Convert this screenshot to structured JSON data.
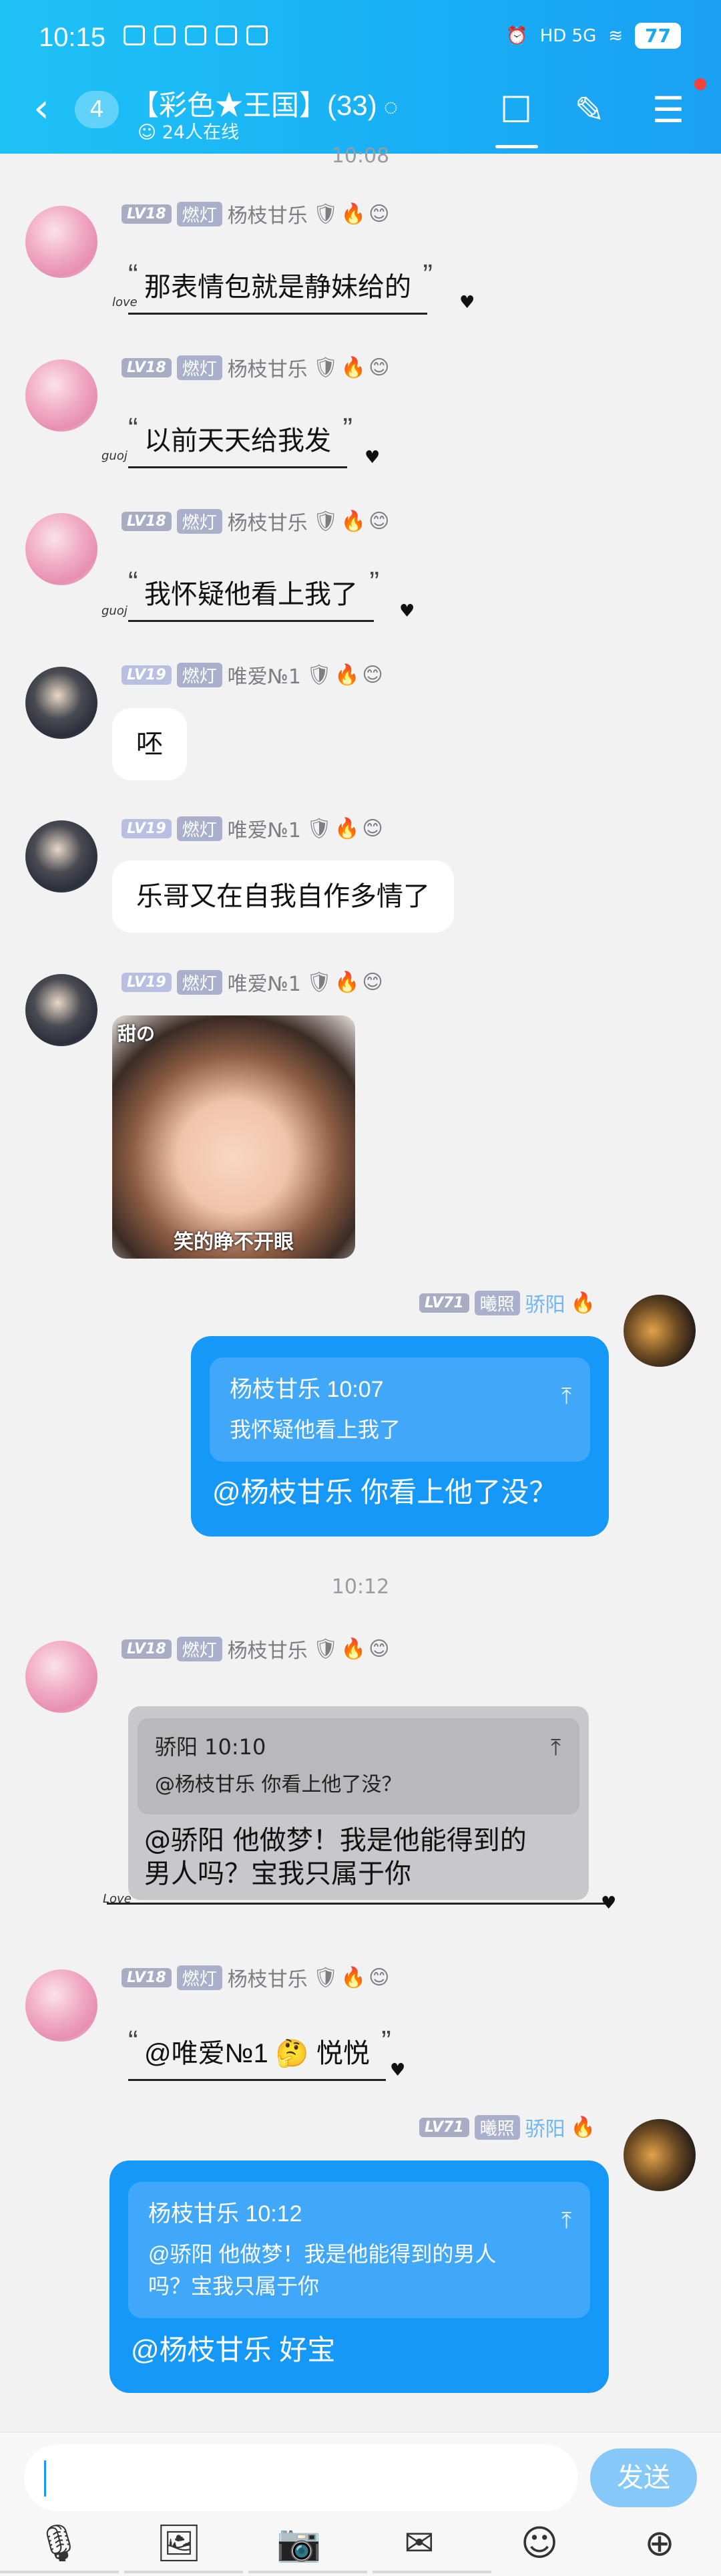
{
  "status_bar": {
    "time": "10:15",
    "network": "HD 5G",
    "battery": "77"
  },
  "header": {
    "back_icon": "chevron-left-icon",
    "unread_count": "4",
    "title": "【彩色★王国】(33)",
    "online": "24人在线",
    "icons": [
      "chat-bubble-icon",
      "edit-note-icon",
      "menu-icon"
    ]
  },
  "top_time": "10:08",
  "messages": [
    {
      "lv": "LV18",
      "badge": "燃灯",
      "nick": "杨枝甘乐",
      "text": "那表情包就是静妹给的",
      "deco_left": "love"
    },
    {
      "lv": "LV18",
      "badge": "燃灯",
      "nick": "杨枝甘乐",
      "text": "以前天天给我发",
      "deco_left": "guoj"
    },
    {
      "lv": "LV18",
      "badge": "燃灯",
      "nick": "杨枝甘乐",
      "text": "我怀疑他看上我了",
      "deco_left": "guoj"
    },
    {
      "lv": "LV19",
      "badge": "燃灯",
      "nick": "唯爱№1",
      "text": "呸"
    },
    {
      "lv": "LV19",
      "badge": "燃灯",
      "nick": "唯爱№1",
      "text": "乐哥又在自我自作多情了"
    },
    {
      "lv": "LV19",
      "badge": "燃灯",
      "nick": "唯爱№1",
      "sticker_top": "甜の",
      "sticker_bottom": "笑的睁不开眼"
    },
    {
      "lv": "LV71",
      "badge": "曦照",
      "nick": "骄阳",
      "quote_head": "杨枝甘乐 10:07",
      "quote_body": "我怀疑他看上我了",
      "text": "@杨枝甘乐 你看上他了没？"
    },
    {
      "lv": "LV18",
      "badge": "燃灯",
      "nick": "杨枝甘乐",
      "quote_head": "骄阳 10:10",
      "quote_body": "@杨枝甘乐 你看上他了没？",
      "text_line1": "@骄阳 他做梦！我是他能得到的",
      "text_line2": "男人吗？宝我只属于你",
      "deco_left": "Love"
    },
    {
      "lv": "LV18",
      "badge": "燃灯",
      "nick": "杨枝甘乐",
      "text": "@唯爱№1",
      "text_after": "悦悦",
      "emoji": "🤔"
    },
    {
      "lv": "LV71",
      "badge": "曦照",
      "nick": "骄阳",
      "quote_head": "杨枝甘乐 10:12",
      "quote_body_line1": "@骄阳 他做梦！我是他能得到的男人",
      "quote_body_line2": "吗？宝我只属于你",
      "text": "@杨枝甘乐 好宝"
    }
  ],
  "mid_time": "10:12",
  "input": {
    "send_label": "发送"
  },
  "toolbar": [
    "microphone-icon",
    "image-icon",
    "camera-icon",
    "red-packet-icon",
    "emoji-icon",
    "plus-icon"
  ],
  "colors": {
    "header": "#1ab0f5",
    "blue_bubble": "#1598f8",
    "send_button": "#86c8f8"
  }
}
